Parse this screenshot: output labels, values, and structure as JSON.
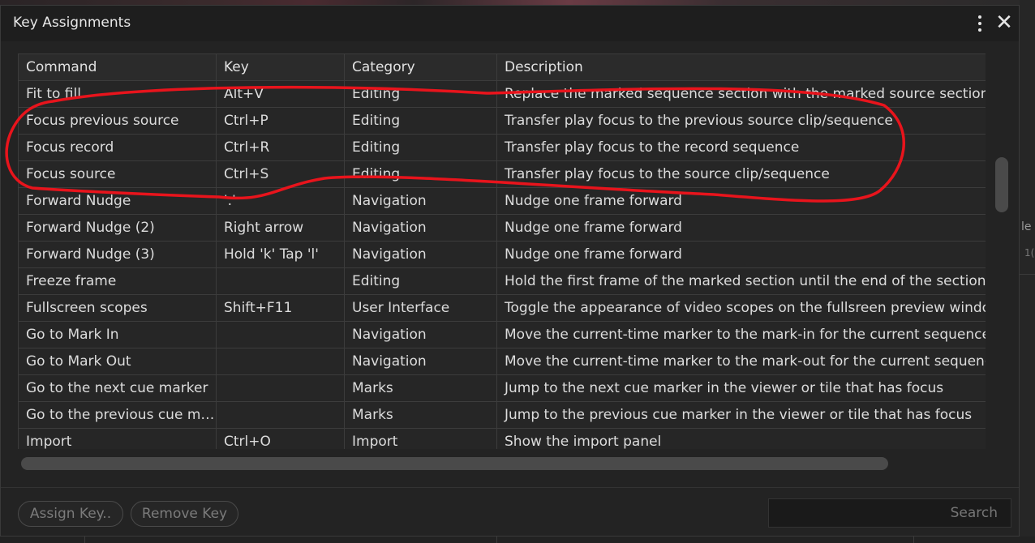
{
  "dialog": {
    "title": "Key Assignments"
  },
  "columns": [
    "Command",
    "Key",
    "Category",
    "Description"
  ],
  "rows": [
    [
      "Fit to fill",
      "Alt+V",
      "Editing",
      "Replace the marked sequence section with the marked source section"
    ],
    [
      "Focus previous source",
      "Ctrl+P",
      "Editing",
      "Transfer play focus to the previous source clip/sequence"
    ],
    [
      "Focus record",
      "Ctrl+R",
      "Editing",
      "Transfer play focus to the record sequence"
    ],
    [
      "Focus source",
      "Ctrl+S",
      "Editing",
      "Transfer play focus to the source clip/sequence"
    ],
    [
      "Forward Nudge",
      "'.'",
      "Navigation",
      "Nudge one frame forward"
    ],
    [
      "Forward Nudge (2)",
      "Right arrow",
      "Navigation",
      "Nudge one frame forward"
    ],
    [
      "Forward Nudge (3)",
      "Hold 'k' Tap 'l'",
      "Navigation",
      "Nudge one frame forward"
    ],
    [
      "Freeze frame",
      "",
      "Editing",
      "Hold the first frame of the marked section until the end of the section ("
    ],
    [
      "Fullscreen scopes",
      "Shift+F11",
      "User Interface",
      "Toggle the appearance of video scopes on the fullsreen preview windo"
    ],
    [
      "Go to Mark In",
      "",
      "Navigation",
      "Move the current-time marker to the mark-in for the current sequence"
    ],
    [
      "Go to Mark Out",
      "",
      "Navigation",
      "Move the current-time marker to the mark-out for the current sequenc"
    ],
    [
      "Go to the next cue marker",
      "",
      "Marks",
      "Jump to the next cue marker in the viewer or tile that has focus"
    ],
    [
      "Go to the previous cue ma..",
      "",
      "Marks",
      "Jump to the previous cue marker in the viewer or tile that has focus"
    ],
    [
      "Import",
      "Ctrl+O",
      "Import",
      "Show the import panel"
    ]
  ],
  "footer": {
    "assign_label": "Assign Key..",
    "remove_label": "Remove Key",
    "search_placeholder": "Search"
  },
  "background": {
    "right_text_1": "le",
    "right_text_2": "1("
  },
  "colors": {
    "annotation": "#e8141c",
    "dialog_bg": "#232323",
    "text": "#dcdcdc"
  }
}
